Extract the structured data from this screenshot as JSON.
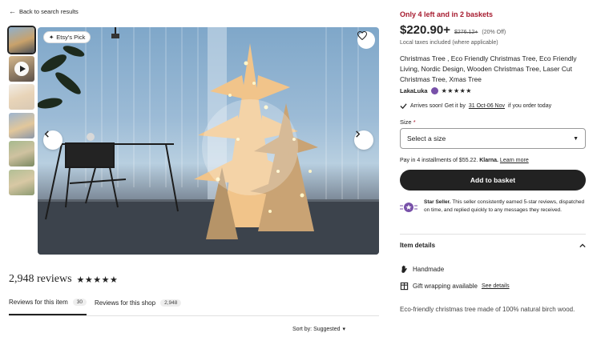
{
  "nav": {
    "back_label": "Back to search results"
  },
  "gallery": {
    "badge_label": "Etsy's Pick",
    "thumbnails": [
      "photo-1",
      "video",
      "photo-3",
      "photo-4",
      "photo-5",
      "photo-6"
    ]
  },
  "reviews": {
    "count_label": "2,948 reviews",
    "rating_stars": "★★★★★",
    "tabs": [
      {
        "label": "Reviews for this item",
        "count": "30",
        "active": true
      },
      {
        "label": "Reviews for this shop",
        "count": "2,948",
        "active": false
      }
    ],
    "sort_label": "Sort by: Suggested"
  },
  "listing": {
    "stock_label": "Only 4 left and in 2 baskets",
    "price": "$220.90+",
    "old_price": "$276.12+",
    "discount": "(20% Off)",
    "tax_note": "Local taxes included (where applicable)",
    "title": "Christmas Tree , Eco Friendly Christmas Tree, Eco Friendly Living, Nordic Design, Wooden Christmas Tree, Laser Cut Christmas Tree, Xmas Tree",
    "shop_name": "LakaLuka",
    "shop_stars": "★★★★★",
    "arrival_prefix": "Arrives soon! Get it by",
    "arrival_dates": "31 Oct-06 Nov",
    "arrival_suffix": "if you order today",
    "size_label": "Size",
    "size_required": "*",
    "size_placeholder": "Select a size",
    "klarna_prefix": "Pay in 4 installments of $55.22.",
    "klarna_brand": "Klarna.",
    "klarna_learn": "Learn more",
    "add_to_basket": "Add to basket",
    "star_seller_title": "Star Seller.",
    "star_seller_text": "This seller consistently earned 5-star reviews, dispatched on time, and replied quickly to any messages they received.",
    "item_details_label": "Item details",
    "handmade_label": "Handmade",
    "gift_label": "Gift wrapping available",
    "see_details": "See details",
    "description": "Eco-friendly christmas tree made of 100% natural birch wood."
  },
  "colors": {
    "stock_red": "#a61a2e",
    "button_black": "#222222",
    "star_seller_purple": "#7851a9"
  }
}
